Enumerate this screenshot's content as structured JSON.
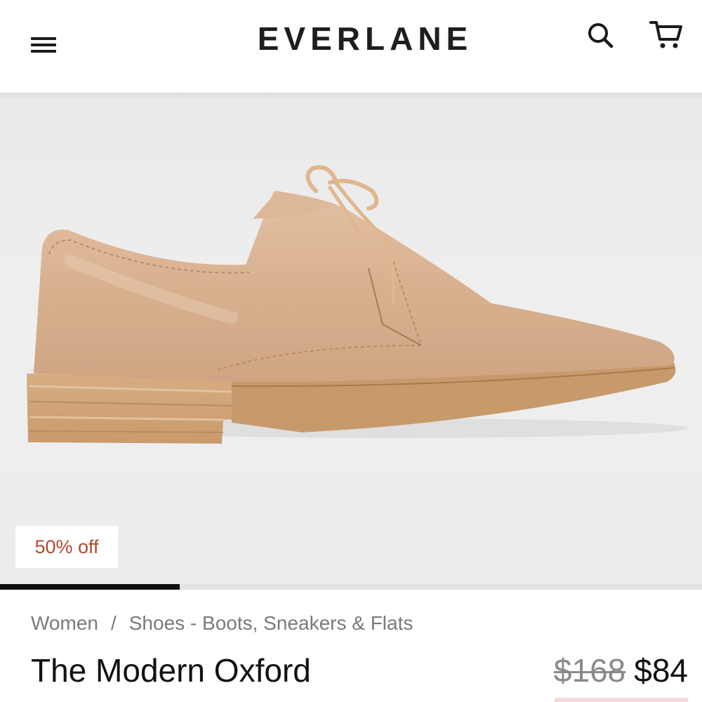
{
  "header": {
    "logo": "EVERLANE",
    "menu_icon": "hamburger-menu-icon",
    "search_icon": "search-icon",
    "cart_icon": "cart-icon"
  },
  "hero": {
    "image": "tan-leather-oxford-shoe",
    "badge": "50% off",
    "carousel_progress": 0.256
  },
  "product": {
    "breadcrumb": [
      "Women",
      "Shoes - Boots, Sneakers & Flats"
    ],
    "breadcrumb_separator": "/",
    "title": "The Modern Oxford",
    "original_price": "$168",
    "sale_price": "$84"
  },
  "colors": {
    "badge_text": "#b14a2e",
    "shoe_leather": "#d8b18f",
    "sole": "#cfa57a"
  }
}
